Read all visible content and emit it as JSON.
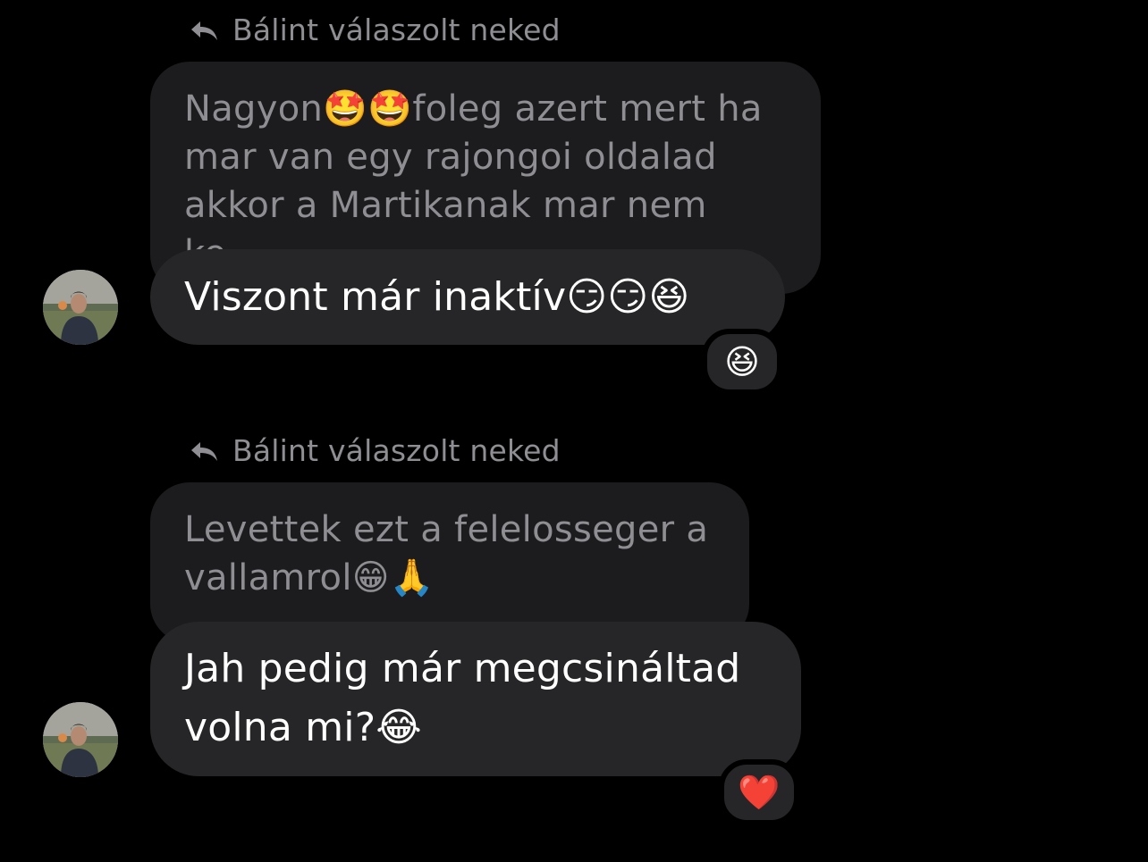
{
  "messages": [
    {
      "reply_header": "Bálint válaszolt neked",
      "quoted_text": "Nagyon🤩🤩foleg azert mert ha mar van egy rajongoi oldalad akkor a Martikanak mar nem ke...",
      "message_text": "Viszont már inaktív😏😏😆",
      "reaction": "😆"
    },
    {
      "reply_header": "Bálint válaszolt neked",
      "quoted_text": "Levettek ezt a felelosseger a vallamrol😁🙏",
      "message_text": "Jah pedig már megcsináltad volna mi?😂",
      "reaction": "❤️"
    }
  ],
  "icons": {
    "reply": "reply-arrow-icon",
    "avatar": "user-avatar"
  },
  "colors": {
    "background": "#000000",
    "bubble": "#262628",
    "quoted_bubble": "#1c1c1e",
    "secondary_text": "#8e8e93",
    "primary_text": "#ffffff"
  }
}
